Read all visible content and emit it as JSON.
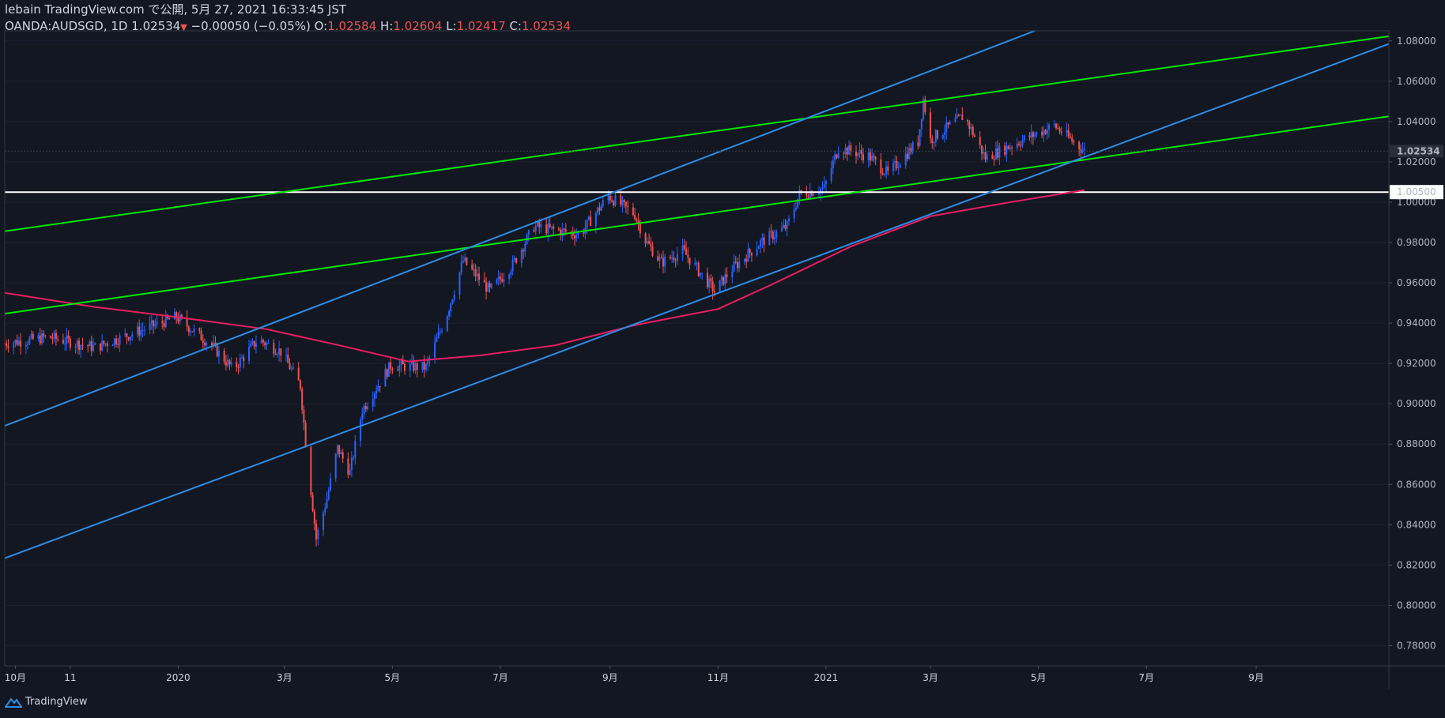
{
  "header": {
    "line1": "lebain TradingView.com で公開, 5月 27, 2021 16:33:45 JST",
    "symbol": "OANDA:AUDSGD, 1D",
    "last": "1.02534",
    "change_arrow": "▼",
    "change": "−0.00050 (−0.05%)",
    "o_label": "O:",
    "o_value": "1.02584",
    "h_label": "H:",
    "h_value": "1.02604",
    "l_label": "L:",
    "l_value": "1.02417",
    "c_label": "C:",
    "c_value": "1.02534"
  },
  "footer": {
    "brand": "TradingView",
    "logo_icon": "tradingview-logo-icon"
  },
  "colors": {
    "background": "#131722",
    "up": "#2962ff",
    "down": "#ef5350",
    "green_line": "#00e600",
    "blue_line": "#2f8de4",
    "ma_line": "#e91e63",
    "hline": "#ffffff"
  },
  "chart_data": {
    "type": "candlestick",
    "symbol": "OANDA:AUDSGD",
    "interval": "1D",
    "ylim": [
      0.77,
      1.085
    ],
    "price_axis": {
      "ticks": [
        "1.08000",
        "1.06000",
        "1.04000",
        "1.02000",
        "1.00000",
        "0.98000",
        "0.96000",
        "0.94000",
        "0.92000",
        "0.90000",
        "0.88000",
        "0.86000",
        "0.84000",
        "0.82000",
        "0.80000",
        "0.78000"
      ],
      "current_price_label": "1.02534",
      "hline_label": "1.00500"
    },
    "time_axis": {
      "ticks": [
        "10月",
        "11",
        "2020",
        "3月",
        "5月",
        "7月",
        "9月",
        "11月",
        "2021",
        "3月",
        "5月",
        "7月",
        "9月"
      ]
    },
    "price_path": [
      {
        "t": "2019-09-25",
        "p": 0.93
      },
      {
        "t": "2019-10-20",
        "p": 0.933
      },
      {
        "t": "2019-11-15",
        "p": 0.928
      },
      {
        "t": "2019-12-31",
        "p": 0.943
      },
      {
        "t": "2020-01-20",
        "p": 0.929
      },
      {
        "t": "2020-02-01",
        "p": 0.917
      },
      {
        "t": "2020-02-15",
        "p": 0.932
      },
      {
        "t": "2020-02-28",
        "p": 0.926
      },
      {
        "t": "2020-03-10",
        "p": 0.909
      },
      {
        "t": "2020-03-13",
        "p": 0.881
      },
      {
        "t": "2020-03-19",
        "p": 0.833
      },
      {
        "t": "2020-03-25",
        "p": 0.853
      },
      {
        "t": "2020-03-31",
        "p": 0.878
      },
      {
        "t": "2020-04-07",
        "p": 0.866
      },
      {
        "t": "2020-04-14",
        "p": 0.897
      },
      {
        "t": "2020-04-30",
        "p": 0.919
      },
      {
        "t": "2020-05-20",
        "p": 0.918
      },
      {
        "t": "2020-06-01",
        "p": 0.945
      },
      {
        "t": "2020-06-10",
        "p": 0.971
      },
      {
        "t": "2020-06-25",
        "p": 0.956
      },
      {
        "t": "2020-07-08",
        "p": 0.969
      },
      {
        "t": "2020-07-20",
        "p": 0.988
      },
      {
        "t": "2020-08-15",
        "p": 0.984
      },
      {
        "t": "2020-08-31",
        "p": 1.003
      },
      {
        "t": "2020-09-15",
        "p": 0.994
      },
      {
        "t": "2020-09-21",
        "p": 0.981
      },
      {
        "t": "2020-09-30",
        "p": 0.97
      },
      {
        "t": "2020-10-12",
        "p": 0.976
      },
      {
        "t": "2020-10-30",
        "p": 0.956
      },
      {
        "t": "2020-11-09",
        "p": 0.967
      },
      {
        "t": "2020-11-25",
        "p": 0.98
      },
      {
        "t": "2020-12-10",
        "p": 0.988
      },
      {
        "t": "2020-12-17",
        "p": 1.004
      },
      {
        "t": "2020-12-31",
        "p": 1.007
      },
      {
        "t": "2021-01-08",
        "p": 1.027
      },
      {
        "t": "2021-01-25",
        "p": 1.023
      },
      {
        "t": "2021-02-05",
        "p": 1.014
      },
      {
        "t": "2021-02-22",
        "p": 1.03
      },
      {
        "t": "2021-02-25",
        "p": 1.051
      },
      {
        "t": "2021-03-01",
        "p": 1.031
      },
      {
        "t": "2021-03-20",
        "p": 1.043
      },
      {
        "t": "2021-04-01",
        "p": 1.022
      },
      {
        "t": "2021-04-20",
        "p": 1.03
      },
      {
        "t": "2021-05-10",
        "p": 1.038
      },
      {
        "t": "2021-05-27",
        "p": 1.02534
      }
    ],
    "overlays": {
      "horizontal_line": 1.005,
      "moving_average": [
        {
          "t": "2019-09-25",
          "p": 0.955
        },
        {
          "t": "2019-11-15",
          "p": 0.948
        },
        {
          "t": "2019-12-31",
          "p": 0.943
        },
        {
          "t": "2020-02-20",
          "p": 0.937
        },
        {
          "t": "2020-04-01",
          "p": 0.929
        },
        {
          "t": "2020-05-10",
          "p": 0.921
        },
        {
          "t": "2020-06-20",
          "p": 0.924
        },
        {
          "t": "2020-08-01",
          "p": 0.929
        },
        {
          "t": "2020-09-15",
          "p": 0.939
        },
        {
          "t": "2020-11-01",
          "p": 0.947
        },
        {
          "t": "2020-12-01",
          "p": 0.959
        },
        {
          "t": "2021-01-15",
          "p": 0.978
        },
        {
          "t": "2021-03-01",
          "p": 0.993
        },
        {
          "t": "2021-04-15",
          "p": 1.0
        },
        {
          "t": "2021-05-27",
          "p": 1.006
        }
      ],
      "trendlines": [
        {
          "color": "green",
          "from": {
            "t": "2019-09-25",
            "p": 0.9856
          },
          "to": {
            "t": "2021-11-15",
            "p": 1.0823
          }
        },
        {
          "color": "green",
          "from": {
            "t": "2019-09-25",
            "p": 0.9447
          },
          "to": {
            "t": "2021-11-15",
            "p": 1.0426
          }
        },
        {
          "color": "blue",
          "from": {
            "t": "2019-09-25",
            "p": 0.8891
          },
          "to": {
            "t": "2021-04-29",
            "p": 1.085
          }
        },
        {
          "color": "blue",
          "from": {
            "t": "2019-09-25",
            "p": 0.8234
          },
          "to": {
            "t": "2021-11-15",
            "p": 1.0785
          }
        }
      ]
    }
  }
}
